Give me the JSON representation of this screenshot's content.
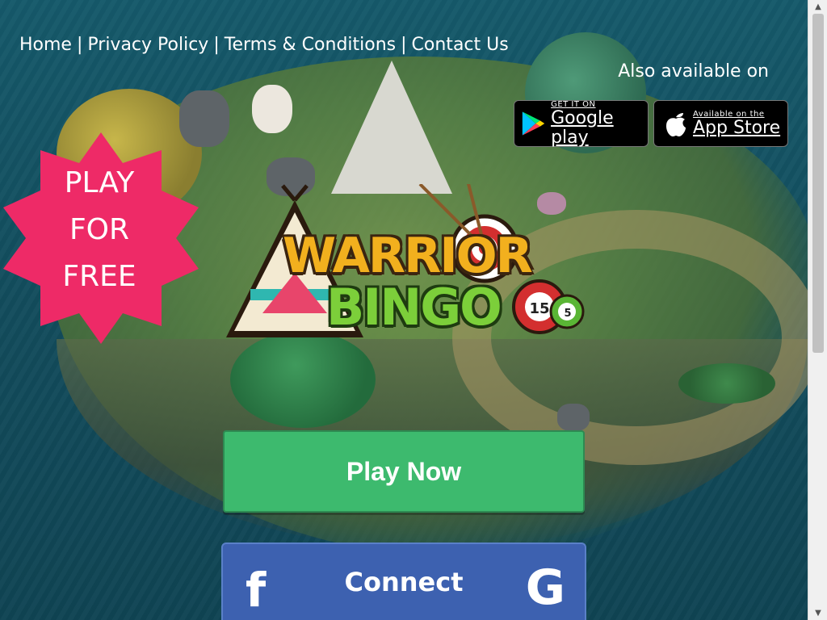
{
  "nav": {
    "items": [
      "Home",
      "Privacy Policy",
      "Terms & Conditions",
      "Contact Us"
    ],
    "separator": "|"
  },
  "stores": {
    "also_available": "Also available on",
    "google": {
      "small": "GET IT ON",
      "big": "Google play"
    },
    "apple": {
      "small": "Available on the",
      "big": "App Store"
    }
  },
  "promo": {
    "line1": "PLAY",
    "line2": "FOR",
    "line3": "FREE",
    "color": "#ee2a67"
  },
  "logo": {
    "word1": "WARRIOR",
    "word2": "BINGO",
    "ball1": "15",
    "ball2": "5"
  },
  "actions": {
    "play_now": "Play Now",
    "connect": "Connect",
    "facebook_icon": "f",
    "google_icon": "G"
  },
  "colors": {
    "play_button": "#3dba6e",
    "connect_button": "#3d61b0",
    "background": "#15596a"
  }
}
